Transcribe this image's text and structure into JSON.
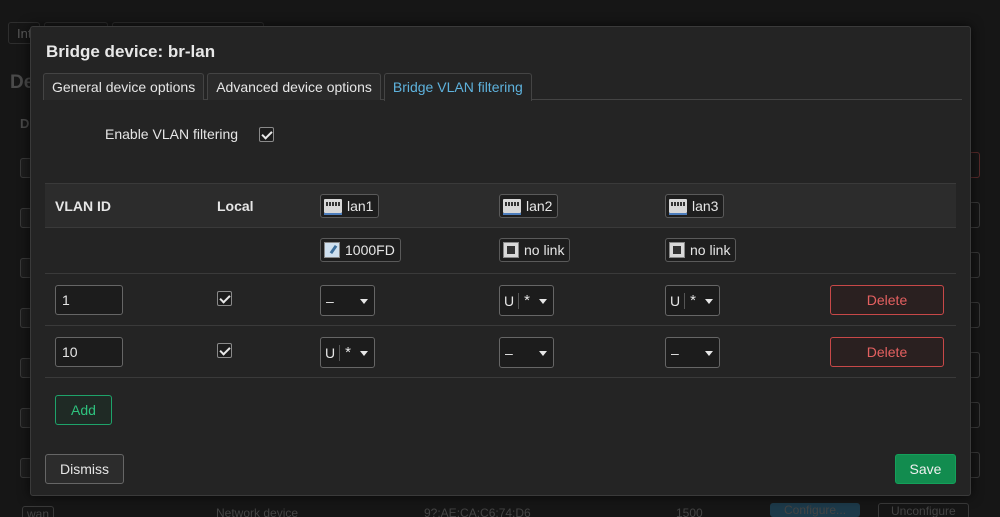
{
  "background": {
    "tabs": [
      "Int",
      "",
      ""
    ],
    "title": "De",
    "column": "D",
    "bottom": {
      "icon_text": "wan",
      "type": "Network device",
      "mac": "9?:AE:CA:C6:74:D6",
      "mtu": "1500",
      "configure": "Configure...",
      "unconfigure": "Unconfigure"
    }
  },
  "modal": {
    "title": "Bridge device: br-lan",
    "tabs": [
      {
        "label": "General device options",
        "active": false
      },
      {
        "label": "Advanced device options",
        "active": false
      },
      {
        "label": "Bridge VLAN filtering",
        "active": true
      }
    ],
    "enable_vlan": {
      "label": "Enable VLAN filtering",
      "checked": true
    },
    "table": {
      "headers": {
        "vlan_id": "VLAN ID",
        "local": "Local"
      },
      "ports": [
        {
          "name": "lan1",
          "status": "1000FD",
          "icon": "ethernet-port-icon",
          "status_icon": "link-up-icon"
        },
        {
          "name": "lan2",
          "status": "no link",
          "icon": "ethernet-port-icon",
          "status_icon": "no-link-icon"
        },
        {
          "name": "lan3",
          "status": "no link",
          "icon": "ethernet-port-icon",
          "status_icon": "no-link-icon"
        }
      ],
      "rows": [
        {
          "vlan_id": "1",
          "local": true,
          "ports": [
            {
              "u": "",
              "star": "",
              "dash": "–"
            },
            {
              "u": "U",
              "star": "*",
              "dash": ""
            },
            {
              "u": "U",
              "star": "*",
              "dash": ""
            }
          ],
          "delete": "Delete"
        },
        {
          "vlan_id": "10",
          "local": true,
          "ports": [
            {
              "u": "U",
              "star": "*",
              "dash": ""
            },
            {
              "u": "",
              "star": "",
              "dash": "–"
            },
            {
              "u": "",
              "star": "",
              "dash": "–"
            }
          ],
          "delete": "Delete"
        }
      ]
    },
    "add_label": "Add",
    "dismiss_label": "Dismiss",
    "save_label": "Save"
  },
  "colors": {
    "accent_tab": "#5eb2dd",
    "save": "#128c4f",
    "add": "#2ec27e",
    "delete": "#e46060"
  }
}
